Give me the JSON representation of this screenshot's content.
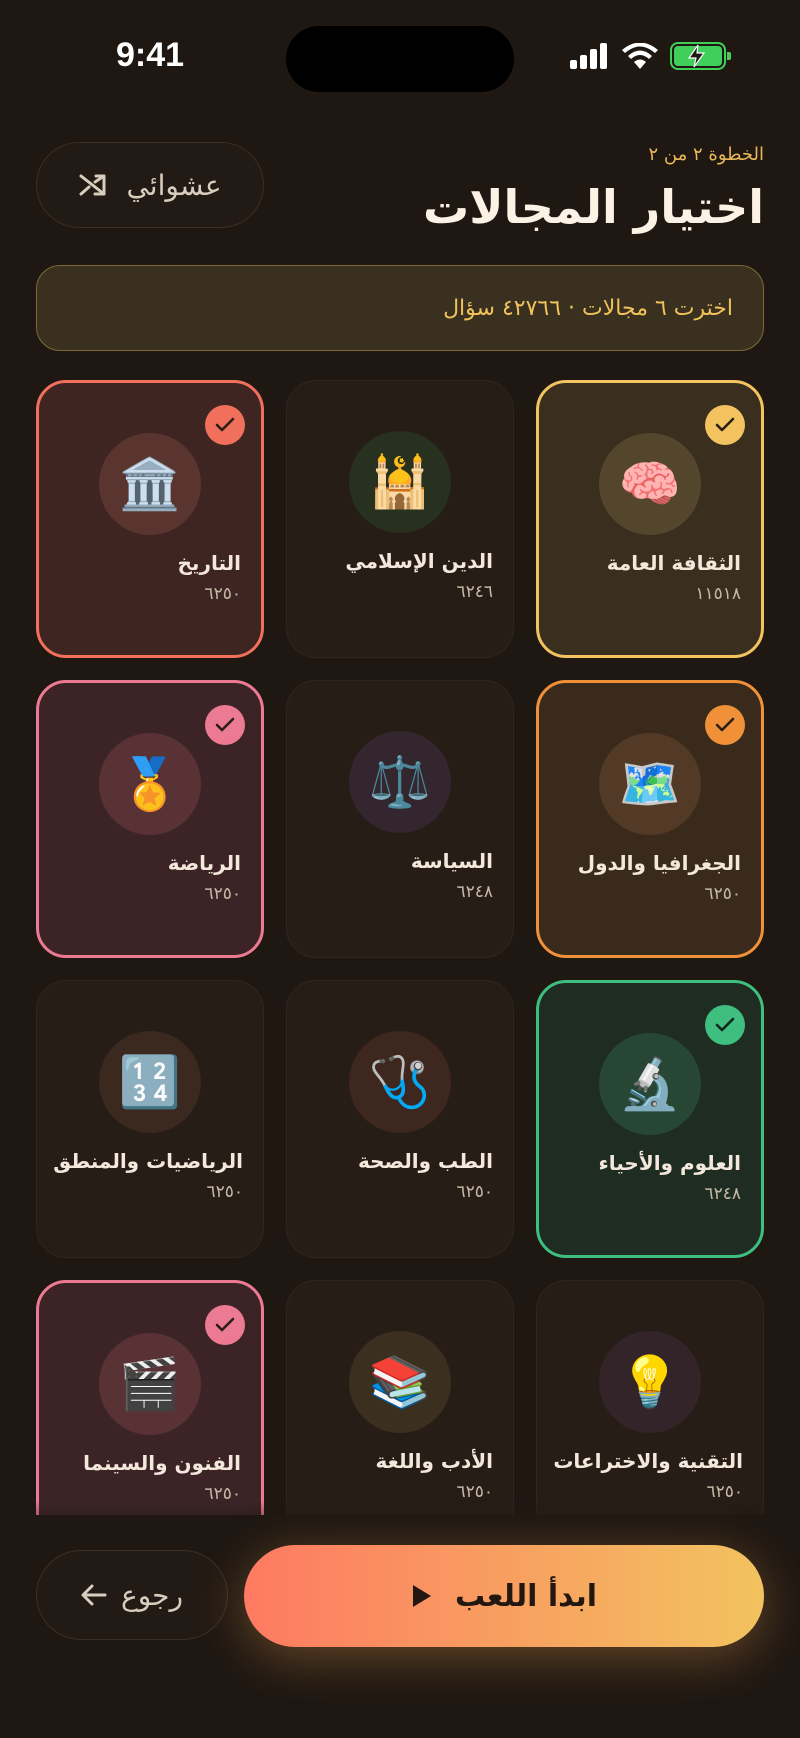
{
  "status_bar": {
    "time": "9:41"
  },
  "header": {
    "step": "الخطوة ٢ من ٢",
    "title": "اختيار المجالات",
    "random_label": "عشوائي"
  },
  "summary": {
    "text": "اخترت ٦ مجالات · ٤٢٧٦٦ سؤال"
  },
  "categories": [
    {
      "label": "الثقافة العامة",
      "count": "١١٥١٨",
      "emoji": "🧠",
      "selected": true
    },
    {
      "label": "الدين الإسلامي",
      "count": "٦٢٤٦",
      "emoji": "🕌",
      "selected": false
    },
    {
      "label": "التاريخ",
      "count": "٦٢٥٠",
      "emoji": "🏛️",
      "selected": true
    },
    {
      "label": "الجغرافيا والدول",
      "count": "٦٢٥٠",
      "emoji": "🗺️",
      "selected": true
    },
    {
      "label": "السياسة",
      "count": "٦٢٤٨",
      "emoji": "⚖️",
      "selected": false
    },
    {
      "label": "الرياضة",
      "count": "٦٢٥٠",
      "emoji": "🏅",
      "selected": true
    },
    {
      "label": "العلوم والأحياء",
      "count": "٦٢٤٨",
      "emoji": "🔬",
      "selected": true
    },
    {
      "label": "الطب والصحة",
      "count": "٦٢٥٠",
      "emoji": "🩺",
      "selected": false
    },
    {
      "label": "الرياضيات والمنطق",
      "count": "٦٢٥٠",
      "emoji": "🔢",
      "selected": false
    },
    {
      "label": "التقنية والاختراعات",
      "count": "٦٢٥٠",
      "emoji": "💡",
      "selected": false
    },
    {
      "label": "الأدب واللغة",
      "count": "٦٢٥٠",
      "emoji": "📚",
      "selected": false
    },
    {
      "label": "الفنون والسينما",
      "count": "٦٢٥٠",
      "emoji": "🎬",
      "selected": true
    }
  ],
  "colors": {
    "accent_yellow": "#f2c35f",
    "accent_orange": "#f0913a",
    "accent_red": "#f0705c",
    "accent_pink": "#ec7a92",
    "accent_green": "#3fbf7f"
  },
  "footer": {
    "back_label": "رجوع",
    "play_label": "ابدأ اللعب"
  }
}
